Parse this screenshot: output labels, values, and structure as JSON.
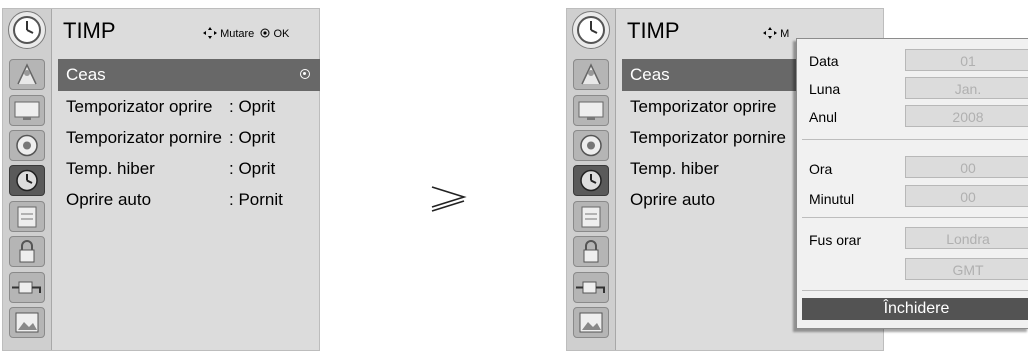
{
  "arrow_symbol": "≥",
  "left_panel": {
    "title": "TIMP",
    "hint": {
      "move_icon": "four-way-arrow-icon",
      "move_label": "Mutare",
      "ok_icon": "ok-dot-icon",
      "ok_label": "OK"
    },
    "sidebar_icons": [
      "clock-icon",
      "antenna-icon",
      "monitor-icon",
      "speaker-icon",
      "clock-icon",
      "schedule-icon",
      "lock-icon",
      "plug-icon",
      "photo-icon"
    ],
    "selected_icon_index": 4,
    "items": [
      {
        "label": "Ceas",
        "value": ""
      },
      {
        "label": "Temporizator oprire",
        "value": ": Oprit"
      },
      {
        "label": "Temporizator pornire",
        "value": ": Oprit"
      },
      {
        "label": "Temp. hiber",
        "value": ": Oprit"
      },
      {
        "label": "Oprire auto",
        "value": ": Pornit"
      }
    ],
    "active_index": 0
  },
  "right_panel": {
    "title": "TIMP",
    "hint_visible": "M",
    "items": [
      {
        "label": "Ceas"
      },
      {
        "label": "Temporizator oprire"
      },
      {
        "label": "Temporizator pornire"
      },
      {
        "label": "Temp. hiber"
      },
      {
        "label": "Oprire auto"
      }
    ],
    "popup": {
      "rows": [
        {
          "label": "Data",
          "value": "01"
        },
        {
          "label": "Luna",
          "value": "Jan."
        },
        {
          "label": "Anul",
          "value": "2008"
        },
        {
          "label": "Ora",
          "value": "00"
        },
        {
          "label": "Minutul",
          "value": "00"
        },
        {
          "label": "Fus orar",
          "value": "Londra"
        },
        {
          "label": "",
          "value": "GMT"
        }
      ],
      "close_label": "Închidere"
    }
  }
}
